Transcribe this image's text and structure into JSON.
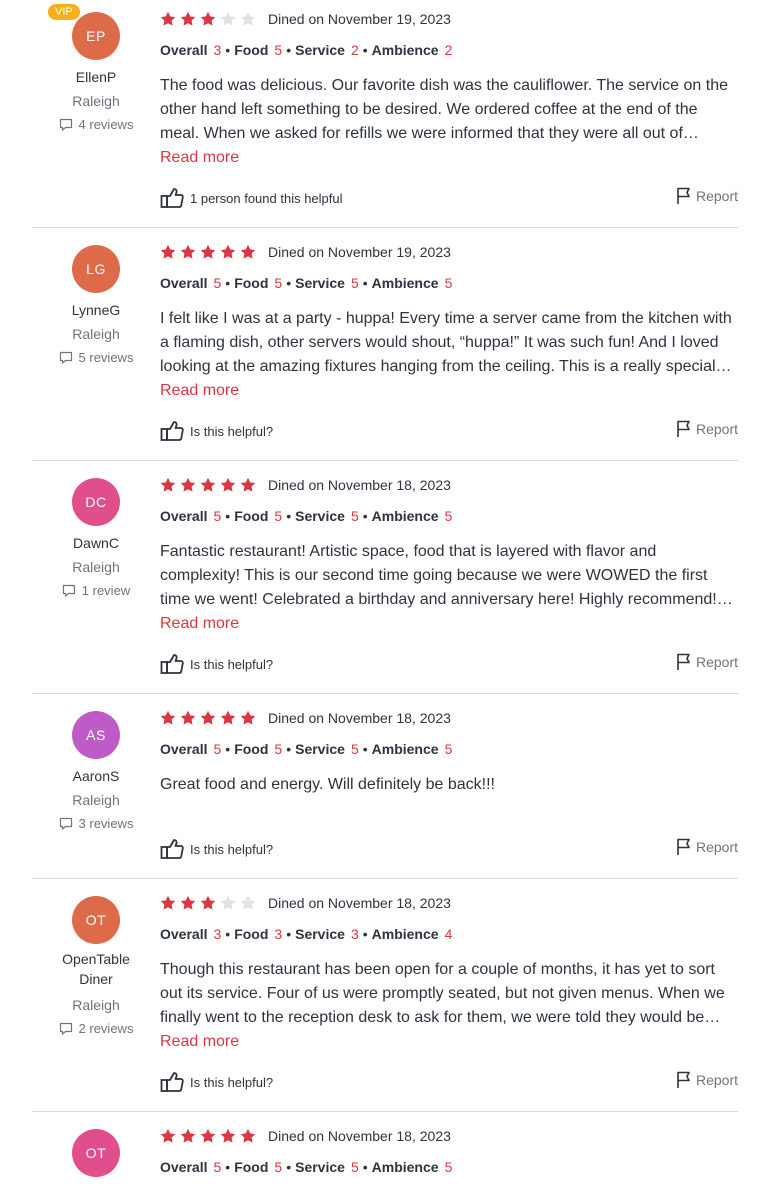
{
  "colors": {
    "accent": "#da3743",
    "star_empty": "#e1e2e4",
    "vip": "#f7b01a"
  },
  "labels": {
    "overall": "Overall",
    "food": "Food",
    "service": "Service",
    "ambience": "Ambience",
    "read_more": "Read more",
    "report": "Report",
    "dot": "•"
  },
  "reviews": [
    {
      "initials": "EP",
      "avatar_color": "#dd6b4a",
      "vip": "VIP",
      "name": "EllenP",
      "city": "Raleigh",
      "review_count": "4 reviews",
      "stars": 3,
      "dined": "Dined on November 19, 2023",
      "overall": "3",
      "food": "5",
      "service": "2",
      "ambience": "2",
      "text": "The food was delicious. Our favorite dish was the cauliflower. The service on the other hand left something to be desired. We ordered coffee at the end of the meal. When we asked for refills we were informed that they were all out of coffee….who runs out of coffee?",
      "read_more": "Read more",
      "helpful": "1 person found this helpful",
      "report": "Report"
    },
    {
      "initials": "LG",
      "avatar_color": "#dd6b4a",
      "name": "LynneG",
      "city": "Raleigh",
      "review_count": "5 reviews",
      "stars": 5,
      "dined": "Dined on November 19, 2023",
      "overall": "5",
      "food": "5",
      "service": "5",
      "ambience": "5",
      "text": "I felt like I was at a party - huppa! Every time a server came from the kitchen with a flaming dish, other servers would shout, “huppa!” It was such fun! And I loved looking at the amazing fixtures hanging from the ceiling. This is a really special place.",
      "read_more": "Read more",
      "helpful": "Is this helpful?",
      "report": "Report"
    },
    {
      "initials": "DC",
      "avatar_color": "#e04e8c",
      "name": "DawnC",
      "city": "Raleigh",
      "review_count": "1 review",
      "stars": 5,
      "dined": "Dined on November 18, 2023",
      "overall": "5",
      "food": "5",
      "service": "5",
      "ambience": "5",
      "text": "Fantastic restaurant! Artistic space, food that is layered with flavor and complexity! This is our second time going because we were WOWED the first time we went! Celebrated a birthday and anniversary here! Highly recommend! Get lots of small plates to share!",
      "read_more": "Read more",
      "helpful": "Is this helpful?",
      "report": "Report"
    },
    {
      "initials": "AS",
      "avatar_color": "#bf5bc7",
      "name": "AaronS",
      "city": "Raleigh",
      "review_count": "3 reviews",
      "stars": 5,
      "dined": "Dined on November 18, 2023",
      "overall": "5",
      "food": "5",
      "service": "5",
      "ambience": "5",
      "text": "Great food and energy.  Will definitely be back!!!",
      "helpful": "Is this helpful?",
      "report": "Report"
    },
    {
      "initials": "OT",
      "avatar_color": "#dd6b4a",
      "name": "OpenTable Diner",
      "city": "Raleigh",
      "review_count": "2 reviews",
      "stars": 3,
      "dined": "Dined on November 18, 2023",
      "overall": "3",
      "food": "3",
      "service": "3",
      "ambience": "4",
      "text": "Though this restaurant has been open for a couple of months, it has yet to sort out its service. Four of us were promptly seated, but not given menus. When we finally went to the reception desk to ask for them, we were told they would be brought to the table.",
      "read_more": "Read more",
      "helpful": "Is this helpful?",
      "report": "Report"
    },
    {
      "initials": "OT",
      "avatar_color": "#e04e8c",
      "stars": 5,
      "dined": "Dined on November 18, 2023",
      "overall": "5",
      "food": "5",
      "service": "5",
      "ambience": "5"
    }
  ]
}
